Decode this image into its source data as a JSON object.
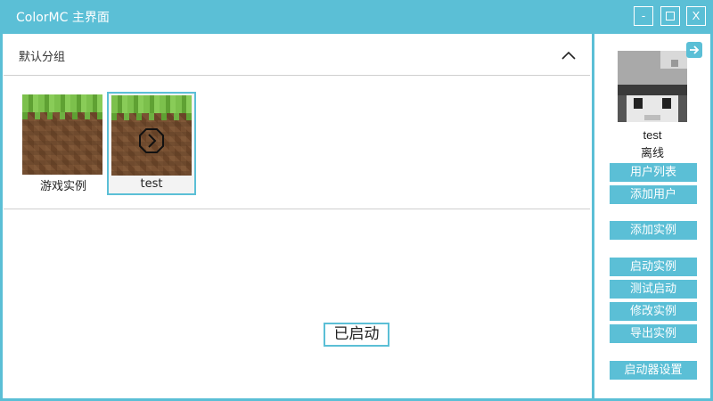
{
  "window": {
    "title": "ColorMC 主界面",
    "controls": {
      "minimize": "-",
      "close": "X"
    }
  },
  "group": {
    "title": "默认分组",
    "instances": [
      {
        "label": "游戏实例"
      },
      {
        "label": "test"
      }
    ]
  },
  "status": "已启动",
  "user": {
    "name": "test",
    "status": "离线"
  },
  "sidebar": {
    "buttons": {
      "user_list": "用户列表",
      "add_user": "添加用户",
      "add_instance": "添加实例",
      "launch_instance": "启动实例",
      "test_launch": "测试启动",
      "edit_instance": "修改实例",
      "export_instance": "导出实例",
      "launcher_settings": "启动器设置"
    }
  },
  "colors": {
    "accent": "#5bbfd6",
    "grass": "#6fb042",
    "dirt": "#7a5233"
  }
}
